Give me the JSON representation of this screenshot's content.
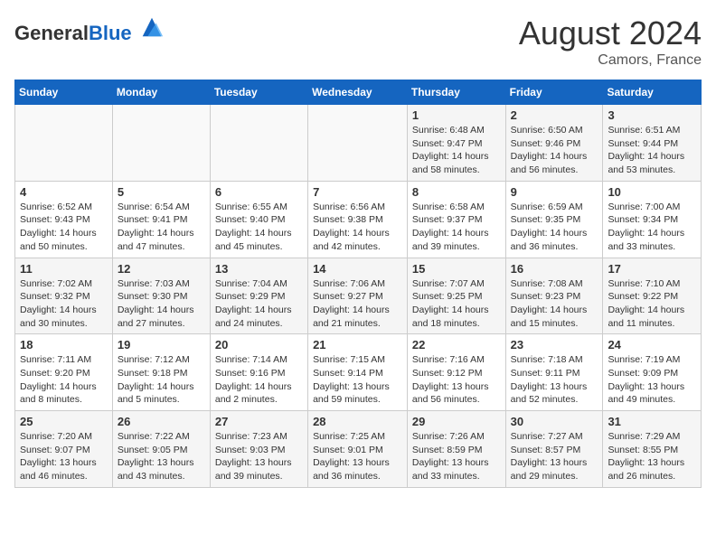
{
  "header": {
    "logo_general": "General",
    "logo_blue": "Blue",
    "month_title": "August 2024",
    "location": "Camors, France"
  },
  "calendar": {
    "days_of_week": [
      "Sunday",
      "Monday",
      "Tuesday",
      "Wednesday",
      "Thursday",
      "Friday",
      "Saturday"
    ],
    "weeks": [
      [
        {
          "day": "",
          "info": ""
        },
        {
          "day": "",
          "info": ""
        },
        {
          "day": "",
          "info": ""
        },
        {
          "day": "",
          "info": ""
        },
        {
          "day": "1",
          "info": "Sunrise: 6:48 AM\nSunset: 9:47 PM\nDaylight: 14 hours\nand 58 minutes."
        },
        {
          "day": "2",
          "info": "Sunrise: 6:50 AM\nSunset: 9:46 PM\nDaylight: 14 hours\nand 56 minutes."
        },
        {
          "day": "3",
          "info": "Sunrise: 6:51 AM\nSunset: 9:44 PM\nDaylight: 14 hours\nand 53 minutes."
        }
      ],
      [
        {
          "day": "4",
          "info": "Sunrise: 6:52 AM\nSunset: 9:43 PM\nDaylight: 14 hours\nand 50 minutes."
        },
        {
          "day": "5",
          "info": "Sunrise: 6:54 AM\nSunset: 9:41 PM\nDaylight: 14 hours\nand 47 minutes."
        },
        {
          "day": "6",
          "info": "Sunrise: 6:55 AM\nSunset: 9:40 PM\nDaylight: 14 hours\nand 45 minutes."
        },
        {
          "day": "7",
          "info": "Sunrise: 6:56 AM\nSunset: 9:38 PM\nDaylight: 14 hours\nand 42 minutes."
        },
        {
          "day": "8",
          "info": "Sunrise: 6:58 AM\nSunset: 9:37 PM\nDaylight: 14 hours\nand 39 minutes."
        },
        {
          "day": "9",
          "info": "Sunrise: 6:59 AM\nSunset: 9:35 PM\nDaylight: 14 hours\nand 36 minutes."
        },
        {
          "day": "10",
          "info": "Sunrise: 7:00 AM\nSunset: 9:34 PM\nDaylight: 14 hours\nand 33 minutes."
        }
      ],
      [
        {
          "day": "11",
          "info": "Sunrise: 7:02 AM\nSunset: 9:32 PM\nDaylight: 14 hours\nand 30 minutes."
        },
        {
          "day": "12",
          "info": "Sunrise: 7:03 AM\nSunset: 9:30 PM\nDaylight: 14 hours\nand 27 minutes."
        },
        {
          "day": "13",
          "info": "Sunrise: 7:04 AM\nSunset: 9:29 PM\nDaylight: 14 hours\nand 24 minutes."
        },
        {
          "day": "14",
          "info": "Sunrise: 7:06 AM\nSunset: 9:27 PM\nDaylight: 14 hours\nand 21 minutes."
        },
        {
          "day": "15",
          "info": "Sunrise: 7:07 AM\nSunset: 9:25 PM\nDaylight: 14 hours\nand 18 minutes."
        },
        {
          "day": "16",
          "info": "Sunrise: 7:08 AM\nSunset: 9:23 PM\nDaylight: 14 hours\nand 15 minutes."
        },
        {
          "day": "17",
          "info": "Sunrise: 7:10 AM\nSunset: 9:22 PM\nDaylight: 14 hours\nand 11 minutes."
        }
      ],
      [
        {
          "day": "18",
          "info": "Sunrise: 7:11 AM\nSunset: 9:20 PM\nDaylight: 14 hours\nand 8 minutes."
        },
        {
          "day": "19",
          "info": "Sunrise: 7:12 AM\nSunset: 9:18 PM\nDaylight: 14 hours\nand 5 minutes."
        },
        {
          "day": "20",
          "info": "Sunrise: 7:14 AM\nSunset: 9:16 PM\nDaylight: 14 hours\nand 2 minutes."
        },
        {
          "day": "21",
          "info": "Sunrise: 7:15 AM\nSunset: 9:14 PM\nDaylight: 13 hours\nand 59 minutes."
        },
        {
          "day": "22",
          "info": "Sunrise: 7:16 AM\nSunset: 9:12 PM\nDaylight: 13 hours\nand 56 minutes."
        },
        {
          "day": "23",
          "info": "Sunrise: 7:18 AM\nSunset: 9:11 PM\nDaylight: 13 hours\nand 52 minutes."
        },
        {
          "day": "24",
          "info": "Sunrise: 7:19 AM\nSunset: 9:09 PM\nDaylight: 13 hours\nand 49 minutes."
        }
      ],
      [
        {
          "day": "25",
          "info": "Sunrise: 7:20 AM\nSunset: 9:07 PM\nDaylight: 13 hours\nand 46 minutes."
        },
        {
          "day": "26",
          "info": "Sunrise: 7:22 AM\nSunset: 9:05 PM\nDaylight: 13 hours\nand 43 minutes."
        },
        {
          "day": "27",
          "info": "Sunrise: 7:23 AM\nSunset: 9:03 PM\nDaylight: 13 hours\nand 39 minutes."
        },
        {
          "day": "28",
          "info": "Sunrise: 7:25 AM\nSunset: 9:01 PM\nDaylight: 13 hours\nand 36 minutes."
        },
        {
          "day": "29",
          "info": "Sunrise: 7:26 AM\nSunset: 8:59 PM\nDaylight: 13 hours\nand 33 minutes."
        },
        {
          "day": "30",
          "info": "Sunrise: 7:27 AM\nSunset: 8:57 PM\nDaylight: 13 hours\nand 29 minutes."
        },
        {
          "day": "31",
          "info": "Sunrise: 7:29 AM\nSunset: 8:55 PM\nDaylight: 13 hours\nand 26 minutes."
        }
      ]
    ]
  }
}
